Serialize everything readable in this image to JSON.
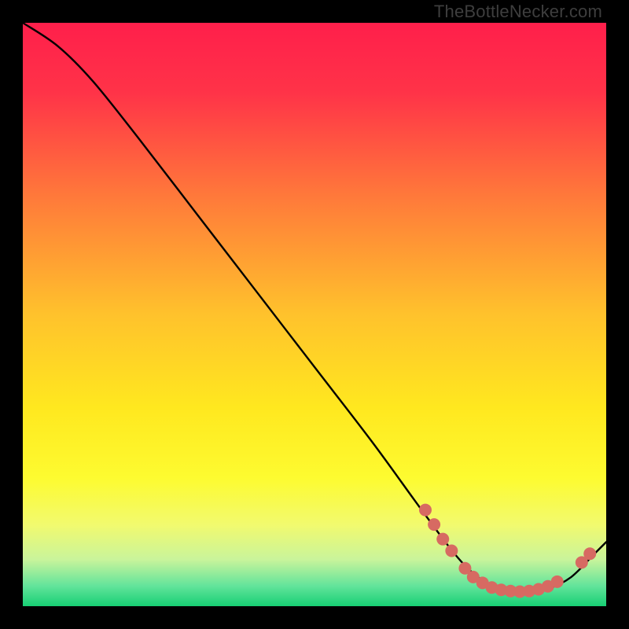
{
  "watermark": "TheBottleNecker.com",
  "chart_data": {
    "type": "line",
    "title": "",
    "xlabel": "",
    "ylabel": "",
    "xlim": [
      0,
      100
    ],
    "ylim": [
      0,
      100
    ],
    "grid": false,
    "gradient_stops": [
      {
        "offset": 0.0,
        "color": "#ff1f4b"
      },
      {
        "offset": 0.12,
        "color": "#ff3348"
      },
      {
        "offset": 0.3,
        "color": "#ff7a3a"
      },
      {
        "offset": 0.5,
        "color": "#ffc22c"
      },
      {
        "offset": 0.66,
        "color": "#ffe81f"
      },
      {
        "offset": 0.78,
        "color": "#fdfb30"
      },
      {
        "offset": 0.86,
        "color": "#f2fa6e"
      },
      {
        "offset": 0.92,
        "color": "#c9f49b"
      },
      {
        "offset": 0.965,
        "color": "#63e49b"
      },
      {
        "offset": 1.0,
        "color": "#17cf74"
      }
    ],
    "curve": {
      "x": [
        0,
        6,
        12,
        20,
        30,
        40,
        50,
        60,
        68,
        74,
        78,
        82,
        86,
        90,
        94,
        98,
        100
      ],
      "y": [
        100,
        96,
        90,
        80,
        67,
        54,
        41,
        28,
        17,
        9,
        5,
        3,
        2.5,
        3,
        5,
        9,
        11
      ]
    },
    "markers": {
      "color": "#d76a62",
      "radius_px": 8,
      "points": [
        {
          "x": 69.0,
          "y": 16.5
        },
        {
          "x": 70.5,
          "y": 14.0
        },
        {
          "x": 72.0,
          "y": 11.5
        },
        {
          "x": 73.5,
          "y": 9.5
        },
        {
          "x": 75.8,
          "y": 6.5
        },
        {
          "x": 77.2,
          "y": 5.0
        },
        {
          "x": 78.8,
          "y": 4.0
        },
        {
          "x": 80.4,
          "y": 3.2
        },
        {
          "x": 82.0,
          "y": 2.8
        },
        {
          "x": 83.6,
          "y": 2.6
        },
        {
          "x": 85.2,
          "y": 2.5
        },
        {
          "x": 86.8,
          "y": 2.6
        },
        {
          "x": 88.4,
          "y": 2.9
        },
        {
          "x": 90.0,
          "y": 3.4
        },
        {
          "x": 91.6,
          "y": 4.2
        },
        {
          "x": 95.8,
          "y": 7.5
        },
        {
          "x": 97.2,
          "y": 9.0
        }
      ]
    }
  }
}
